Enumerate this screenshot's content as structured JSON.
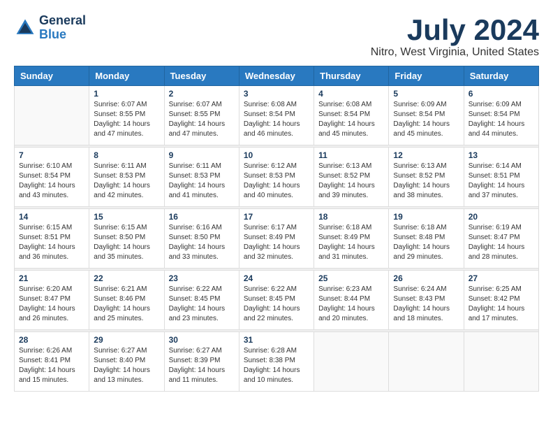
{
  "header": {
    "logo_line1": "General",
    "logo_line2": "Blue",
    "title": "July 2024",
    "subtitle": "Nitro, West Virginia, United States"
  },
  "calendar": {
    "days_of_week": [
      "Sunday",
      "Monday",
      "Tuesday",
      "Wednesday",
      "Thursday",
      "Friday",
      "Saturday"
    ],
    "weeks": [
      [
        {
          "day": "",
          "sunrise": "",
          "sunset": "",
          "daylight": ""
        },
        {
          "day": "1",
          "sunrise": "6:07 AM",
          "sunset": "8:55 PM",
          "daylight": "14 hours and 47 minutes."
        },
        {
          "day": "2",
          "sunrise": "6:07 AM",
          "sunset": "8:55 PM",
          "daylight": "14 hours and 47 minutes."
        },
        {
          "day": "3",
          "sunrise": "6:08 AM",
          "sunset": "8:54 PM",
          "daylight": "14 hours and 46 minutes."
        },
        {
          "day": "4",
          "sunrise": "6:08 AM",
          "sunset": "8:54 PM",
          "daylight": "14 hours and 45 minutes."
        },
        {
          "day": "5",
          "sunrise": "6:09 AM",
          "sunset": "8:54 PM",
          "daylight": "14 hours and 45 minutes."
        },
        {
          "day": "6",
          "sunrise": "6:09 AM",
          "sunset": "8:54 PM",
          "daylight": "14 hours and 44 minutes."
        }
      ],
      [
        {
          "day": "7",
          "sunrise": "6:10 AM",
          "sunset": "8:54 PM",
          "daylight": "14 hours and 43 minutes."
        },
        {
          "day": "8",
          "sunrise": "6:11 AM",
          "sunset": "8:53 PM",
          "daylight": "14 hours and 42 minutes."
        },
        {
          "day": "9",
          "sunrise": "6:11 AM",
          "sunset": "8:53 PM",
          "daylight": "14 hours and 41 minutes."
        },
        {
          "day": "10",
          "sunrise": "6:12 AM",
          "sunset": "8:53 PM",
          "daylight": "14 hours and 40 minutes."
        },
        {
          "day": "11",
          "sunrise": "6:13 AM",
          "sunset": "8:52 PM",
          "daylight": "14 hours and 39 minutes."
        },
        {
          "day": "12",
          "sunrise": "6:13 AM",
          "sunset": "8:52 PM",
          "daylight": "14 hours and 38 minutes."
        },
        {
          "day": "13",
          "sunrise": "6:14 AM",
          "sunset": "8:51 PM",
          "daylight": "14 hours and 37 minutes."
        }
      ],
      [
        {
          "day": "14",
          "sunrise": "6:15 AM",
          "sunset": "8:51 PM",
          "daylight": "14 hours and 36 minutes."
        },
        {
          "day": "15",
          "sunrise": "6:15 AM",
          "sunset": "8:50 PM",
          "daylight": "14 hours and 35 minutes."
        },
        {
          "day": "16",
          "sunrise": "6:16 AM",
          "sunset": "8:50 PM",
          "daylight": "14 hours and 33 minutes."
        },
        {
          "day": "17",
          "sunrise": "6:17 AM",
          "sunset": "8:49 PM",
          "daylight": "14 hours and 32 minutes."
        },
        {
          "day": "18",
          "sunrise": "6:18 AM",
          "sunset": "8:49 PM",
          "daylight": "14 hours and 31 minutes."
        },
        {
          "day": "19",
          "sunrise": "6:18 AM",
          "sunset": "8:48 PM",
          "daylight": "14 hours and 29 minutes."
        },
        {
          "day": "20",
          "sunrise": "6:19 AM",
          "sunset": "8:47 PM",
          "daylight": "14 hours and 28 minutes."
        }
      ],
      [
        {
          "day": "21",
          "sunrise": "6:20 AM",
          "sunset": "8:47 PM",
          "daylight": "14 hours and 26 minutes."
        },
        {
          "day": "22",
          "sunrise": "6:21 AM",
          "sunset": "8:46 PM",
          "daylight": "14 hours and 25 minutes."
        },
        {
          "day": "23",
          "sunrise": "6:22 AM",
          "sunset": "8:45 PM",
          "daylight": "14 hours and 23 minutes."
        },
        {
          "day": "24",
          "sunrise": "6:22 AM",
          "sunset": "8:45 PM",
          "daylight": "14 hours and 22 minutes."
        },
        {
          "day": "25",
          "sunrise": "6:23 AM",
          "sunset": "8:44 PM",
          "daylight": "14 hours and 20 minutes."
        },
        {
          "day": "26",
          "sunrise": "6:24 AM",
          "sunset": "8:43 PM",
          "daylight": "14 hours and 18 minutes."
        },
        {
          "day": "27",
          "sunrise": "6:25 AM",
          "sunset": "8:42 PM",
          "daylight": "14 hours and 17 minutes."
        }
      ],
      [
        {
          "day": "28",
          "sunrise": "6:26 AM",
          "sunset": "8:41 PM",
          "daylight": "14 hours and 15 minutes."
        },
        {
          "day": "29",
          "sunrise": "6:27 AM",
          "sunset": "8:40 PM",
          "daylight": "14 hours and 13 minutes."
        },
        {
          "day": "30",
          "sunrise": "6:27 AM",
          "sunset": "8:39 PM",
          "daylight": "14 hours and 11 minutes."
        },
        {
          "day": "31",
          "sunrise": "6:28 AM",
          "sunset": "8:38 PM",
          "daylight": "14 hours and 10 minutes."
        },
        {
          "day": "",
          "sunrise": "",
          "sunset": "",
          "daylight": ""
        },
        {
          "day": "",
          "sunrise": "",
          "sunset": "",
          "daylight": ""
        },
        {
          "day": "",
          "sunrise": "",
          "sunset": "",
          "daylight": ""
        }
      ]
    ]
  }
}
